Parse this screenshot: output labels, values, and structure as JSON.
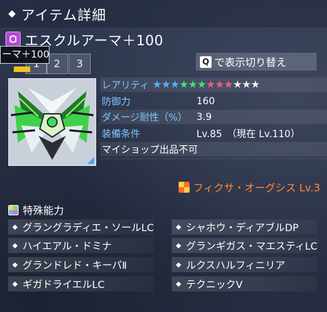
{
  "header": {
    "title": "アイテム詳細",
    "marker_icon": "diamond-icon"
  },
  "item": {
    "name": "エスクルアーマ＋100",
    "category_icon": "rear-armor-category-icon",
    "tooltip": "ーマ＋100"
  },
  "tabs": [
    {
      "label": "1"
    },
    {
      "label": "2"
    },
    {
      "label": "3"
    }
  ],
  "toggle": {
    "key": "Q",
    "label": "で表示切り替え"
  },
  "stats": {
    "rarity_label": "レアリティ",
    "rarity_stars": [
      {
        "color": "#4fb8ff"
      },
      {
        "color": "#4fb8ff"
      },
      {
        "color": "#4fb8ff"
      },
      {
        "color": "#45e36a"
      },
      {
        "color": "#45e36a"
      },
      {
        "color": "#45e36a"
      },
      {
        "color": "#ff5a7a"
      },
      {
        "color": "#ff5a7a"
      },
      {
        "color": "#ff5a7a"
      },
      {
        "color": "#eef2f7"
      },
      {
        "color": "#eef2f7"
      },
      {
        "color": "#eef2f7"
      }
    ],
    "defense_label": "防御力",
    "defense_value": "160",
    "resist_label": "ダメージ耐性（%）",
    "resist_value": "3.9",
    "requirement_label": "装備条件",
    "requirement_value": "Lv.85　（現在 Lv.110）",
    "note": "マイショップ出品不可"
  },
  "fixa": {
    "label": "フィクサ・オーグシス Lv.3",
    "color": "#ff8a3a"
  },
  "special": {
    "heading": "特殊能力",
    "abilities": [
      "グラングラディエ・ソールLC",
      "シャホウ・ディアブルDP",
      "ハイエアル・ドミナ",
      "グランギガス・マエスティLC",
      "グランドレド・キーパⅡ",
      "ルクスハルフィニリア",
      "ギガドライエルLC",
      "テクニックⅤ"
    ]
  }
}
